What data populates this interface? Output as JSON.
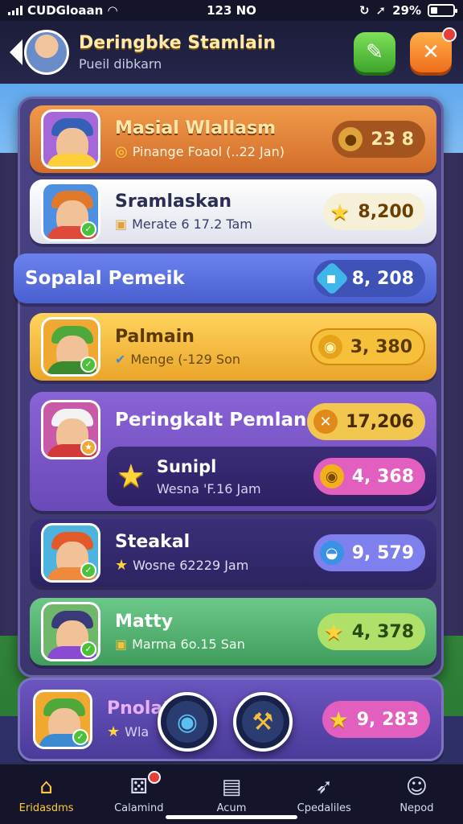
{
  "status": {
    "carrier": "CUDGloaan",
    "time": "123 NO",
    "battery": "29%"
  },
  "header": {
    "title": "Deringbke Stamlain",
    "subtitle": "Pueil dibkarn"
  },
  "rows": [
    {
      "name": "Masial Wlallasm",
      "sub": "Pinange Foaol (..22 Jan)",
      "score": "23  8"
    },
    {
      "name": "Sramlaskan",
      "sub": "Merate 6 17.2 Tam",
      "score": "8,200"
    },
    {
      "name": "Sopalal  Pemeik",
      "score": "8, 208"
    },
    {
      "name": "Palmain",
      "sub": "Menge (-129 Son",
      "score": "3, 380"
    },
    {
      "name": "Peringkalt Pemlan",
      "score": "17,206"
    },
    {
      "name": "Sunipl",
      "sub": "Wesna 'F.16 Jam",
      "score": "4, 368"
    },
    {
      "name": "Steakal",
      "sub": "Wosne 62229 Jam",
      "score": "9, 579"
    },
    {
      "name": "Matty",
      "sub": "Marma 6o.15 San",
      "score": "4, 378"
    },
    {
      "name": "Pnolat",
      "sub": "Wla",
      "score": "9, 283"
    }
  ],
  "nav": [
    {
      "label": "Eridasdms"
    },
    {
      "label": "Calamind"
    },
    {
      "label": "Acum"
    },
    {
      "label": "Cpedaliles"
    },
    {
      "label": "Nepod"
    }
  ],
  "icons": [
    "back-icon",
    "edit-icon",
    "close-icon",
    "coin-icon",
    "star-icon",
    "gem-icon",
    "home-icon",
    "dice-icon",
    "clipboard-icon",
    "rocket-icon",
    "profile-icon"
  ],
  "colors": {
    "orange_row": "#e0823a",
    "white_row": "#eef0f5",
    "blue_row": "#5a72e0",
    "yellow_row": "#f0b73a",
    "purple_row": "#6c4fb8",
    "green_row": "#4fb36a"
  }
}
